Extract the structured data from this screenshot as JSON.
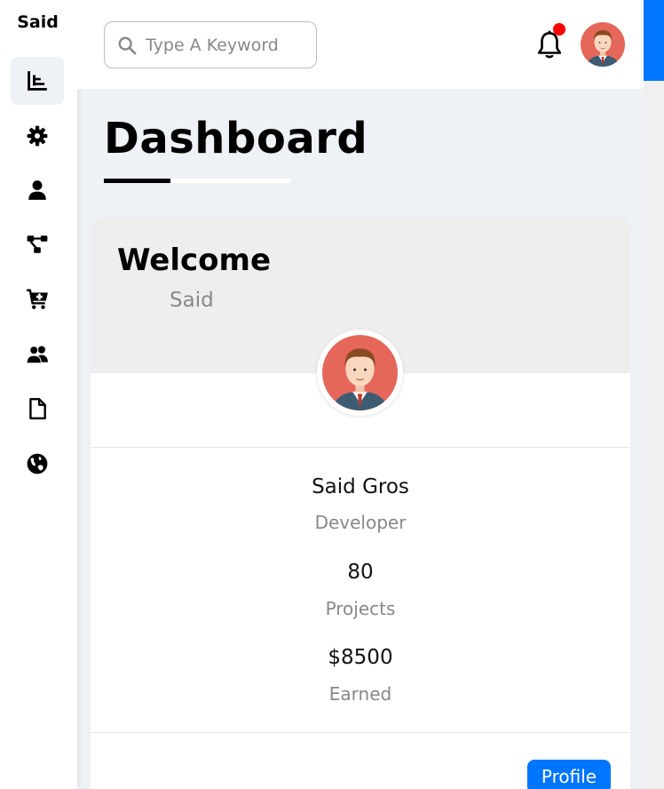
{
  "brand": "Said",
  "nav": [
    {
      "icon": "chart-bar-icon",
      "active": true
    },
    {
      "icon": "gear-icon",
      "active": false
    },
    {
      "icon": "user-icon",
      "active": false
    },
    {
      "icon": "diagram-project-icon",
      "active": false
    },
    {
      "icon": "cart-plus-icon",
      "active": false
    },
    {
      "icon": "users-icon",
      "active": false
    },
    {
      "icon": "file-icon",
      "active": false
    },
    {
      "icon": "globe-icon",
      "active": false
    }
  ],
  "header": {
    "search_placeholder": "Type A Keyword",
    "search_value": "",
    "notification_dot": true
  },
  "page_title": "Dashboard",
  "welcome_card": {
    "heading": "Welcome",
    "name": "Said",
    "full_name": "Said Gros",
    "role": "Developer",
    "stats": [
      {
        "value": "80",
        "label": "Projects"
      },
      {
        "value": "$8500",
        "label": "Earned"
      }
    ],
    "button_label": "Profile"
  },
  "colors": {
    "accent": "#0075ff",
    "notification": "#ff0000",
    "background": "#eef1f6"
  }
}
